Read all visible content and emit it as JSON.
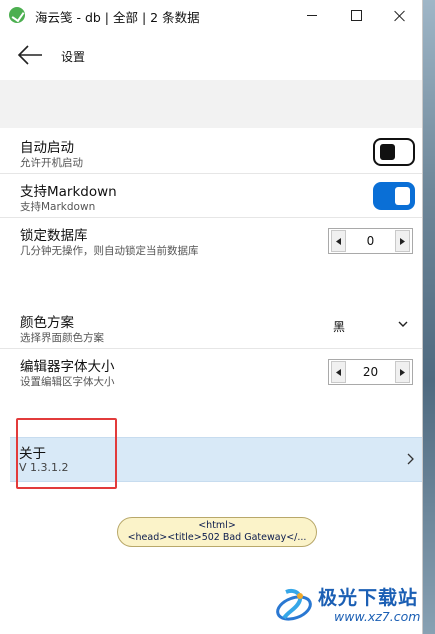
{
  "window": {
    "title": "海云笺 - db | 全部 | 2 条数据"
  },
  "header": {
    "title": "设置"
  },
  "settings": {
    "auto_start": {
      "label": "自动启动",
      "desc": "允许开机启动",
      "enabled": false
    },
    "markdown": {
      "label": "支持Markdown",
      "desc": "支持Markdown",
      "enabled": true
    },
    "lock_db": {
      "label": "锁定数据库",
      "desc": "几分钟无操作，则自动锁定当前数据库",
      "value": "0"
    },
    "color_scheme": {
      "label": "颜色方案",
      "desc": "选择界面颜色方案",
      "selected": "黑"
    },
    "font_size": {
      "label": "编辑器字体大小",
      "desc": "设置编辑区字体大小",
      "value": "20"
    }
  },
  "about": {
    "label": "关于",
    "version": "V 1.3.1.2"
  },
  "error_bubble": {
    "line1": "<html>",
    "line2": "<head><title>502 Bad Gateway</..."
  },
  "watermark": {
    "brand": "极光下载站",
    "url": "www.xz7.com"
  },
  "colors": {
    "accent": "#0a6fd6",
    "about_bg": "#d8e9f7",
    "highlight": "#e23b3b"
  },
  "icons": [
    "app-logo-icon",
    "minimize-icon",
    "maximize-icon",
    "close-icon",
    "back-arrow-icon",
    "chevron-down-icon",
    "chevron-right-icon",
    "triangle-left-icon",
    "triangle-right-icon"
  ]
}
